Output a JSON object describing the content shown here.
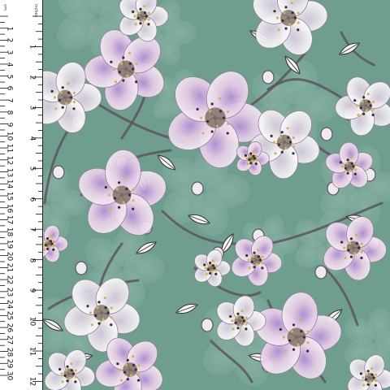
{
  "image": {
    "subject": "fabric print swatch",
    "background_color": "#6f9e8f",
    "petal_colors": [
      "#f3eef6",
      "#d9b6dc",
      "#b58fd6",
      "#eadff0"
    ],
    "branch_color": "#5b5560",
    "leaf_color": "#f4f4f4"
  },
  "ruler": {
    "cm_labels": [
      "1",
      "2",
      "3",
      "4",
      "5",
      "6",
      "7",
      "8",
      "9",
      "10",
      "11",
      "12",
      "13",
      "14",
      "15",
      "16",
      "17",
      "18",
      "19",
      "20",
      "21",
      "22",
      "23",
      "24",
      "25",
      "26",
      "27",
      "28",
      "29",
      "30"
    ],
    "inch_labels": [
      "1",
      "2",
      "3",
      "4",
      "5",
      "6",
      "7",
      "8",
      "9",
      "10",
      "11",
      "12"
    ],
    "cm_unit": "cm",
    "inch_unit": "inches"
  }
}
